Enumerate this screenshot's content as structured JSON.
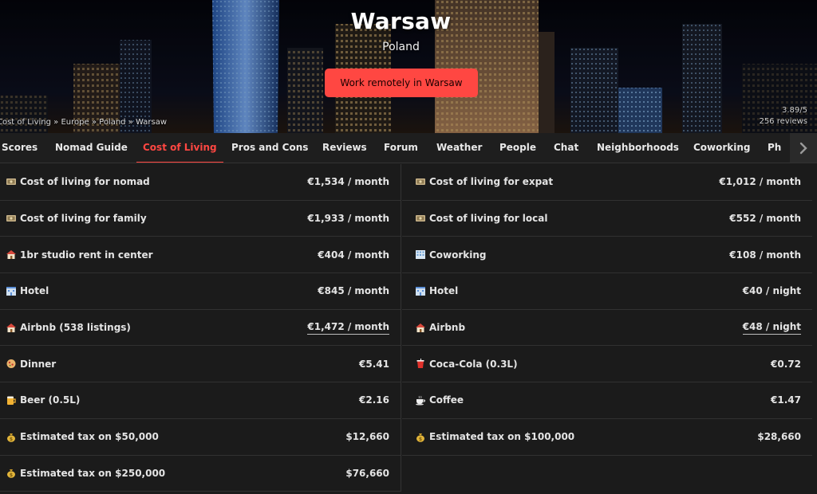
{
  "hero": {
    "city": "Warsaw",
    "country": "Poland",
    "cta_label": "Work remotely in Warsaw",
    "rating": "3.89/5",
    "reviews": "256 reviews"
  },
  "breadcrumb": [
    "Cost of Living",
    "Europe",
    "Poland",
    "Warsaw"
  ],
  "breadcrumb_sep": "»",
  "tabs": [
    "Scores",
    "Nomad Guide",
    "Cost of Living",
    "Pros and Cons",
    "Reviews",
    "Forum",
    "Weather",
    "People",
    "Chat",
    "Neighborhoods",
    "Coworking",
    "Ph"
  ],
  "active_tab": "Cost of Living",
  "costs": {
    "left": [
      {
        "icon": "money-icon",
        "label": "Cost of living for nomad",
        "value": "€1,534 / month",
        "link": false
      },
      {
        "icon": "money-icon",
        "label": "Cost of living for family",
        "value": "€1,933 / month",
        "link": false
      },
      {
        "icon": "house-icon",
        "label": "1br studio rent in center",
        "value": "€404 / month",
        "link": false
      },
      {
        "icon": "hotel-icon",
        "label": "Hotel",
        "value": "€845 / month",
        "link": false
      },
      {
        "icon": "house-icon",
        "label": "Airbnb (538 listings)",
        "value": "€1,472 / month",
        "link": true
      },
      {
        "icon": "pizza-icon",
        "label": "Dinner",
        "value": "€5.41",
        "link": false
      },
      {
        "icon": "beer-icon",
        "label": "Beer (0.5L)",
        "value": "€2.16",
        "link": false
      },
      {
        "icon": "money-bag-icon",
        "label": "Estimated tax on $50,000",
        "value": "$12,660",
        "link": false
      },
      {
        "icon": "money-bag-icon",
        "label": "Estimated tax on $250,000",
        "value": "$76,660",
        "link": false
      }
    ],
    "right": [
      {
        "icon": "money-icon",
        "label": "Cost of living for expat",
        "value": "€1,012 / month",
        "link": false
      },
      {
        "icon": "money-icon",
        "label": "Cost of living for local",
        "value": "€552 / month",
        "link": false
      },
      {
        "icon": "office-icon",
        "label": "Coworking",
        "value": "€108 / month",
        "link": false
      },
      {
        "icon": "hotel-icon",
        "label": "Hotel",
        "value": "€40 / night",
        "link": false
      },
      {
        "icon": "house-icon",
        "label": "Airbnb",
        "value": "€48 / night",
        "link": true
      },
      {
        "icon": "soda-cup-icon",
        "label": "Coca-Cola (0.3L)",
        "value": "€0.72",
        "link": false
      },
      {
        "icon": "coffee-icon",
        "label": "Coffee",
        "value": "€1.47",
        "link": false
      },
      {
        "icon": "money-bag-icon",
        "label": "Estimated tax on $100,000",
        "value": "$28,660",
        "link": false
      }
    ]
  },
  "colors": {
    "accent": "#ff4742",
    "background": "#1b1b1b"
  }
}
